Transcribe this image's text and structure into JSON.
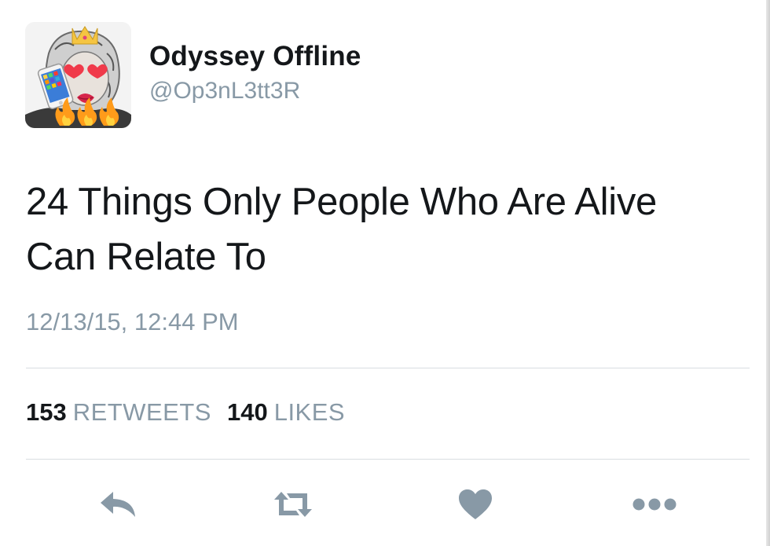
{
  "author": {
    "display_name": "Odyssey Offline",
    "handle": "@Op3nL3tt3R",
    "avatar_icon": "statue-with-emoji-avatar"
  },
  "tweet": {
    "text": "24 Things Only People Who Are Alive Can Relate To",
    "timestamp": "12/13/15, 12:44 PM"
  },
  "stats": {
    "retweets_count": "153",
    "retweets_label": "RETWEETS",
    "likes_count": "140",
    "likes_label": "LIKES"
  },
  "actions": [
    {
      "name": "reply",
      "icon": "reply-icon"
    },
    {
      "name": "retweet",
      "icon": "retweet-icon"
    },
    {
      "name": "like",
      "icon": "heart-icon"
    },
    {
      "name": "more",
      "icon": "more-dots-icon"
    }
  ],
  "colors": {
    "text": "#14171a",
    "muted": "#8899a6",
    "divider": "#d8dde1",
    "icon": "#8899a6"
  }
}
